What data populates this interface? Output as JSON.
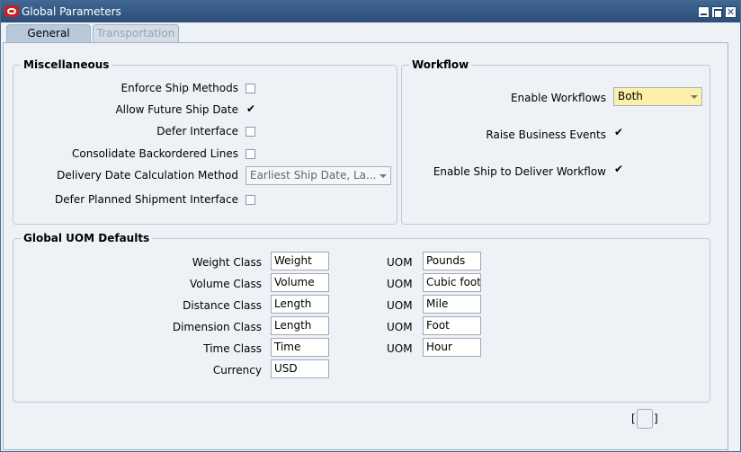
{
  "window": {
    "title": "Global Parameters"
  },
  "tabs": [
    {
      "label": "General",
      "active": true
    },
    {
      "label": "Transportation",
      "active": false
    }
  ],
  "misc": {
    "title": "Miscellaneous",
    "enforce_ship_methods": {
      "label": "Enforce Ship Methods",
      "checked": false
    },
    "allow_future_ship_date": {
      "label": "Allow Future Ship Date",
      "checked": true
    },
    "defer_interface": {
      "label": "Defer Interface",
      "checked": false
    },
    "consolidate_backordered": {
      "label": "Consolidate Backordered Lines",
      "checked": false
    },
    "delivery_date_calc": {
      "label": "Delivery Date Calculation Method",
      "value": "Earliest Ship Date, La..."
    },
    "defer_planned_shipment": {
      "label": "Defer Planned Shipment Interface",
      "checked": false
    }
  },
  "workflow": {
    "title": "Workflow",
    "enable_workflows": {
      "label": "Enable Workflows",
      "value": "Both"
    },
    "raise_business_events": {
      "label": "Raise Business Events",
      "checked": true
    },
    "enable_ship_to_deliver": {
      "label": "Enable Ship to Deliver Workflow",
      "checked": true
    }
  },
  "uom": {
    "title": "Global UOM Defaults",
    "uom_label": "UOM",
    "rows": [
      {
        "label": "Weight Class",
        "class_value": "Weight",
        "uom_value": "Pounds"
      },
      {
        "label": "Volume Class",
        "class_value": "Volume",
        "uom_value": "Cubic foot"
      },
      {
        "label": "Distance Class",
        "class_value": "Length",
        "uom_value": "Mile"
      },
      {
        "label": "Dimension Class",
        "class_value": "Length",
        "uom_value": "Foot"
      },
      {
        "label": "Time Class",
        "class_value": "Time",
        "uom_value": "Hour"
      }
    ],
    "currency": {
      "label": "Currency",
      "value": "USD"
    }
  },
  "flex": {
    "open": "[",
    "close": "]"
  },
  "icons": {
    "check": "✔",
    "close": "✕"
  }
}
